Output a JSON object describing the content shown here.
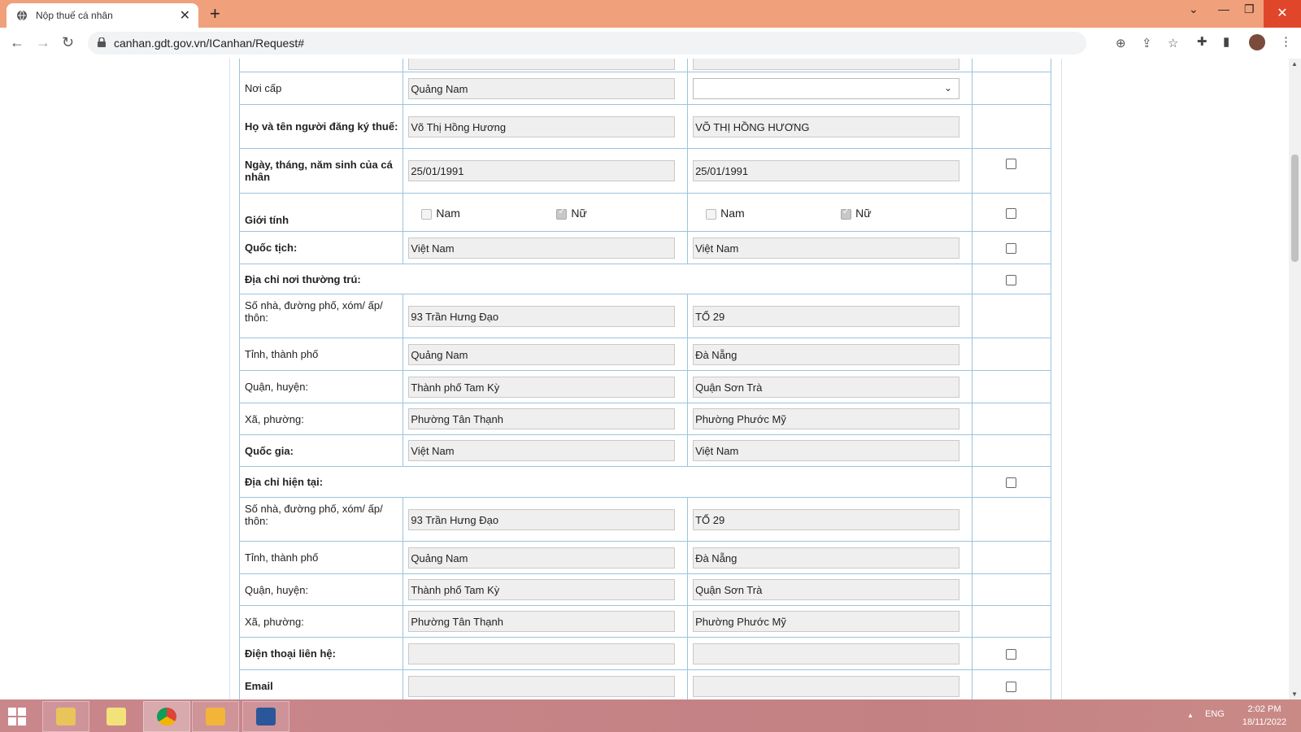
{
  "browser": {
    "tab_title": "Nộp thuế cá nhân",
    "url": "canhan.gdt.gov.vn/ICanhan/Request#",
    "close_tab": "✕",
    "new_tab": "+"
  },
  "form": {
    "rows": [
      {
        "label": "Nơi cấp",
        "bold": false,
        "left": "Quảng Nam",
        "right_type": "select",
        "right": "",
        "checkbox": false
      },
      {
        "label": "Họ và tên người đăng ký thuế:",
        "bold": true,
        "left": "Võ Thị Hồng Hương",
        "right": "VÕ THỊ HỒNG HƯƠNG",
        "checkbox": false
      },
      {
        "label": "Ngày, tháng, năm sinh của cá nhân",
        "bold": true,
        "left": "25/01/1991",
        "right": "25/01/1991",
        "checkbox": true
      }
    ],
    "gender": {
      "label": "Giới tính",
      "male": "Nam",
      "female": "Nữ",
      "left_female_checked": true,
      "right_female_checked": true
    },
    "nationality": {
      "label": "Quốc tịch:",
      "left": "Việt Nam",
      "right": "Việt Nam"
    },
    "permanent_address": {
      "heading": "Địa chỉ nơi thường trú:",
      "rows": [
        {
          "label": "Số nhà, đường phố, xóm/ ấp/ thôn:",
          "left": "93 Trần Hưng Đạo",
          "right": "TỔ 29"
        },
        {
          "label": "Tỉnh, thành phố",
          "left": "Quảng Nam",
          "right": "Đà Nẵng"
        },
        {
          "label": "Quận, huyện:",
          "left": "Thành phố Tam Kỳ",
          "right": "Quận Sơn Trà"
        },
        {
          "label": "Xã, phường:",
          "left": "Phường Tân Thạnh",
          "right": "Phường Phước Mỹ"
        },
        {
          "label": "Quốc gia:",
          "left": "Việt Nam",
          "right": "Việt Nam"
        }
      ]
    },
    "current_address": {
      "heading": "Địa chỉ hiện tại:",
      "rows": [
        {
          "label": "Số nhà, đường phố, xóm/ ấp/ thôn:",
          "left": "93 Trần Hưng Đạo",
          "right": "TỔ 29"
        },
        {
          "label": "Tỉnh, thành phố",
          "left": "Quảng Nam",
          "right": "Đà Nẵng"
        },
        {
          "label": "Quận, huyện:",
          "left": "Thành phố Tam Kỳ",
          "right": "Quận Sơn Trà"
        },
        {
          "label": "Xã, phường:",
          "left": "Phường Tân Thạnh",
          "right": "Phường Phước Mỹ"
        }
      ]
    },
    "phone": {
      "label": "Điện thoại liên hệ:",
      "left": "",
      "right": ""
    },
    "email": {
      "label": "Email",
      "left": "",
      "right": ""
    }
  },
  "taskbar": {
    "lang": "ENG",
    "time": "2:02 PM",
    "date": "18/11/2022",
    "tray_arrow": "▲"
  },
  "colors": {
    "titlebar": "#f0a07a",
    "table_border": "#9cc3de",
    "field_bg": "#efefef",
    "taskbar": "#c48184"
  }
}
